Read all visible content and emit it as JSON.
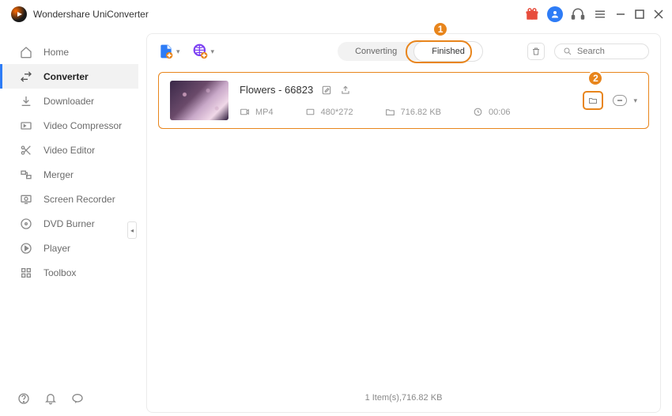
{
  "app": {
    "title": "Wondershare UniConverter"
  },
  "sidebar": {
    "items": [
      {
        "label": "Home"
      },
      {
        "label": "Converter"
      },
      {
        "label": "Downloader"
      },
      {
        "label": "Video Compressor"
      },
      {
        "label": "Video Editor"
      },
      {
        "label": "Merger"
      },
      {
        "label": "Screen Recorder"
      },
      {
        "label": "DVD Burner"
      },
      {
        "label": "Player"
      },
      {
        "label": "Toolbox"
      }
    ]
  },
  "tabs": {
    "converting": "Converting",
    "finished": "Finished"
  },
  "search": {
    "placeholder": "Search"
  },
  "file": {
    "title": "Flowers - 66823",
    "format": "MP4",
    "resolution": "480*272",
    "size": "716.82 KB",
    "duration": "00:06"
  },
  "callouts": {
    "one": "1",
    "two": "2"
  },
  "status": "1 Item(s),716.82 KB"
}
